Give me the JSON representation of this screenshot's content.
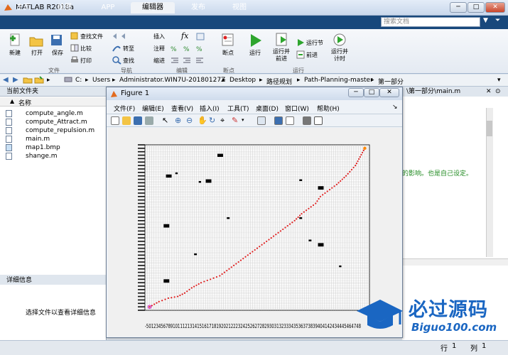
{
  "window": {
    "title": "MATLAB R2018a",
    "minimize": "─",
    "maximize": "□",
    "close": "✕"
  },
  "tabs": [
    "主页",
    "绘图",
    "APP",
    "编辑器",
    "发布",
    "视图"
  ],
  "active_tab": "编辑器",
  "search_placeholder": "搜索文档",
  "ribbon": {
    "new": "新建",
    "open": "打开",
    "save": "保存",
    "find_files": "查找文件",
    "compare": "比较",
    "print": "打印",
    "goto": "转至",
    "find": "查找",
    "insert": "插入",
    "comment": "注释",
    "indent": "缩进",
    "fx": "fx",
    "breakpoints": "断点",
    "run": "运行",
    "run_advance": "运行并\n前进",
    "run_section": "运行节",
    "advance": "前进",
    "run_time": "运行并\n计时",
    "groups": {
      "file": "文件",
      "nav": "导航",
      "edit": "编辑",
      "bp": "断点",
      "run": "运行"
    }
  },
  "address": [
    "C:",
    "Users",
    "Administrator.WIN7U-20180127Z",
    "Desktop",
    "路径规划",
    "Path-Planning-master",
    "第一部分"
  ],
  "current_folder": {
    "title": "当前文件夹",
    "column": "名称",
    "files": [
      "compute_angle.m",
      "compute_Attract.m",
      "compute_repulsion.m",
      "main.m",
      "map1.bmp",
      "shange.m"
    ]
  },
  "details": {
    "title": "详细信息",
    "message": "选择文件以查看详细信息"
  },
  "editor_right": {
    "path": "\\第一部分\\main.m",
    "code_comment": "的影响。也是自己设定。"
  },
  "status": {
    "row_label": "行",
    "row": "1",
    "col_label": "列",
    "col": "1"
  },
  "figure": {
    "title": "Figure 1",
    "menu": [
      "文件(F)",
      "编辑(E)",
      "查看(V)",
      "插入(I)",
      "工具(T)",
      "桌面(D)",
      "窗口(W)",
      "帮助(H)"
    ],
    "x_ticks_text": "-50123456789101112131415161718192021222324252627282930313233343536373839404142434445464748"
  },
  "watermark": {
    "text": "必过源码",
    "url": "Biguo100.com"
  },
  "chart_data": {
    "type": "scatter",
    "title": "",
    "xlim": [
      0,
      48
    ],
    "ylim": [
      0,
      48
    ],
    "grid": true,
    "obstacles": [
      {
        "x": 15.5,
        "y": 44.5,
        "w": 1.2,
        "h": 0.9
      },
      {
        "x": 4.5,
        "y": 38.5,
        "w": 1.2,
        "h": 0.9
      },
      {
        "x": 6.5,
        "y": 39.5,
        "w": 0.5,
        "h": 0.5
      },
      {
        "x": 13,
        "y": 37,
        "w": 1.2,
        "h": 1
      },
      {
        "x": 11.5,
        "y": 37,
        "w": 0.5,
        "h": 0.5
      },
      {
        "x": 4,
        "y": 24,
        "w": 1.2,
        "h": 1
      },
      {
        "x": 17.5,
        "y": 26.5,
        "w": 0.6,
        "h": 0.5
      },
      {
        "x": 33,
        "y": 37.5,
        "w": 0.6,
        "h": 0.5
      },
      {
        "x": 37,
        "y": 35,
        "w": 1.2,
        "h": 1
      },
      {
        "x": 33,
        "y": 26.5,
        "w": 0.6,
        "h": 0.5
      },
      {
        "x": 35,
        "y": 20,
        "w": 0.6,
        "h": 0.5
      },
      {
        "x": 37,
        "y": 18.5,
        "w": 1.2,
        "h": 1
      },
      {
        "x": 10.5,
        "y": 16,
        "w": 0.6,
        "h": 0.5
      },
      {
        "x": 4,
        "y": 8,
        "w": 1.2,
        "h": 1
      },
      {
        "x": 41.5,
        "y": 12.5,
        "w": 0.5,
        "h": 0.5
      }
    ],
    "path": {
      "start": [
        1,
        1
      ],
      "goal": [
        47,
        47
      ],
      "points": [
        [
          1,
          1
        ],
        [
          3,
          2.5
        ],
        [
          5,
          3.5
        ],
        [
          7,
          4
        ],
        [
          8.5,
          5
        ],
        [
          10,
          6.5
        ],
        [
          12,
          8
        ],
        [
          14,
          9
        ],
        [
          16,
          10
        ],
        [
          18,
          12
        ],
        [
          20,
          14
        ],
        [
          22,
          16
        ],
        [
          24,
          18
        ],
        [
          26,
          20
        ],
        [
          28,
          22
        ],
        [
          30,
          24
        ],
        [
          32,
          26
        ],
        [
          33.5,
          28
        ],
        [
          35,
          29.5
        ],
        [
          36.5,
          31
        ],
        [
          37.5,
          33
        ],
        [
          39,
          34.5
        ],
        [
          41,
          36.5
        ],
        [
          43,
          39
        ],
        [
          45,
          42
        ],
        [
          47,
          47
        ]
      ]
    },
    "path_color": "#e02020",
    "start_color": "#cc33cc",
    "goal_color": "#ff8800"
  }
}
